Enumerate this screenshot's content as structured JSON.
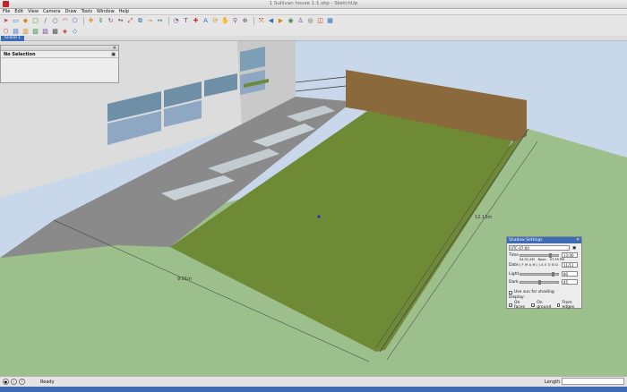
{
  "window": {
    "title": "1 Sullivan house 1:1.skp - SketchUp"
  },
  "menubar": {
    "items": [
      "File",
      "Edit",
      "View",
      "Camera",
      "Draw",
      "Tools",
      "Window",
      "Help"
    ]
  },
  "toolbar_icons": [
    "select-icon",
    "eraser-icon",
    "paint-bucket-icon",
    "rectangle-icon",
    "line-icon",
    "circle-icon",
    "arc-icon",
    "polygon-icon",
    "move-icon",
    "push-pull-icon",
    "rotate-icon",
    "follow-me-icon",
    "scale-icon",
    "offset-icon",
    "tape-measure-icon",
    "dimension-icon",
    "protractor-icon",
    "text-icon",
    "axes-icon",
    "3d-text-icon",
    "orbit-icon",
    "pan-icon",
    "zoom-icon",
    "zoom-window-icon",
    "zoom-extents-icon",
    "previous-view-icon",
    "next-view-icon",
    "position-camera-icon",
    "walk-icon",
    "look-around-icon",
    "section-plane-icon",
    "sandbox-icon"
  ],
  "toolbar2_icons": [
    "iso-view-icon",
    "top-view-icon",
    "front-view-icon",
    "right-view-icon",
    "back-view-icon",
    "left-view-icon",
    "shaded-textures-icon",
    "monochrome-icon"
  ],
  "scenes": {
    "active": "Scene 1"
  },
  "entity_panel": {
    "title": "Entity Info",
    "selection": "No Selection"
  },
  "dimensions": {
    "width": "9.01m",
    "length": "12.13m"
  },
  "shadow_settings": {
    "title": "Shadow Settings",
    "timezone": "UTC-07:00",
    "time_label": "Time",
    "time_start": "04:31 AM",
    "time_mid": "Noon",
    "time_end": "07:39 PM",
    "time_value": "13:00",
    "date_label": "Date",
    "months": "J F M A M J J A S O N D",
    "date_value": "11/11",
    "light_label": "Light",
    "light_value": "80",
    "dark_label": "Dark",
    "dark_value": "45",
    "use_sun_label": "Use sun for shading",
    "display_label": "Display:",
    "on_faces_label": "On faces",
    "on_ground_label": "On ground",
    "from_edges_label": "From edges",
    "on_faces_checked": true,
    "on_ground_checked": true,
    "from_edges_checked": false
  },
  "statusbar": {
    "status": "Ready",
    "length_label": "Length",
    "length_value": ""
  },
  "colors": {
    "sky": "#c8d8ea",
    "ground": "#9cbf8c",
    "lawn": "#6e8a34",
    "paving": "#8a8a8a",
    "brick_wall": "#8a6a3c",
    "wall": "#dcdcdc",
    "accent": "#3d6bb4"
  }
}
